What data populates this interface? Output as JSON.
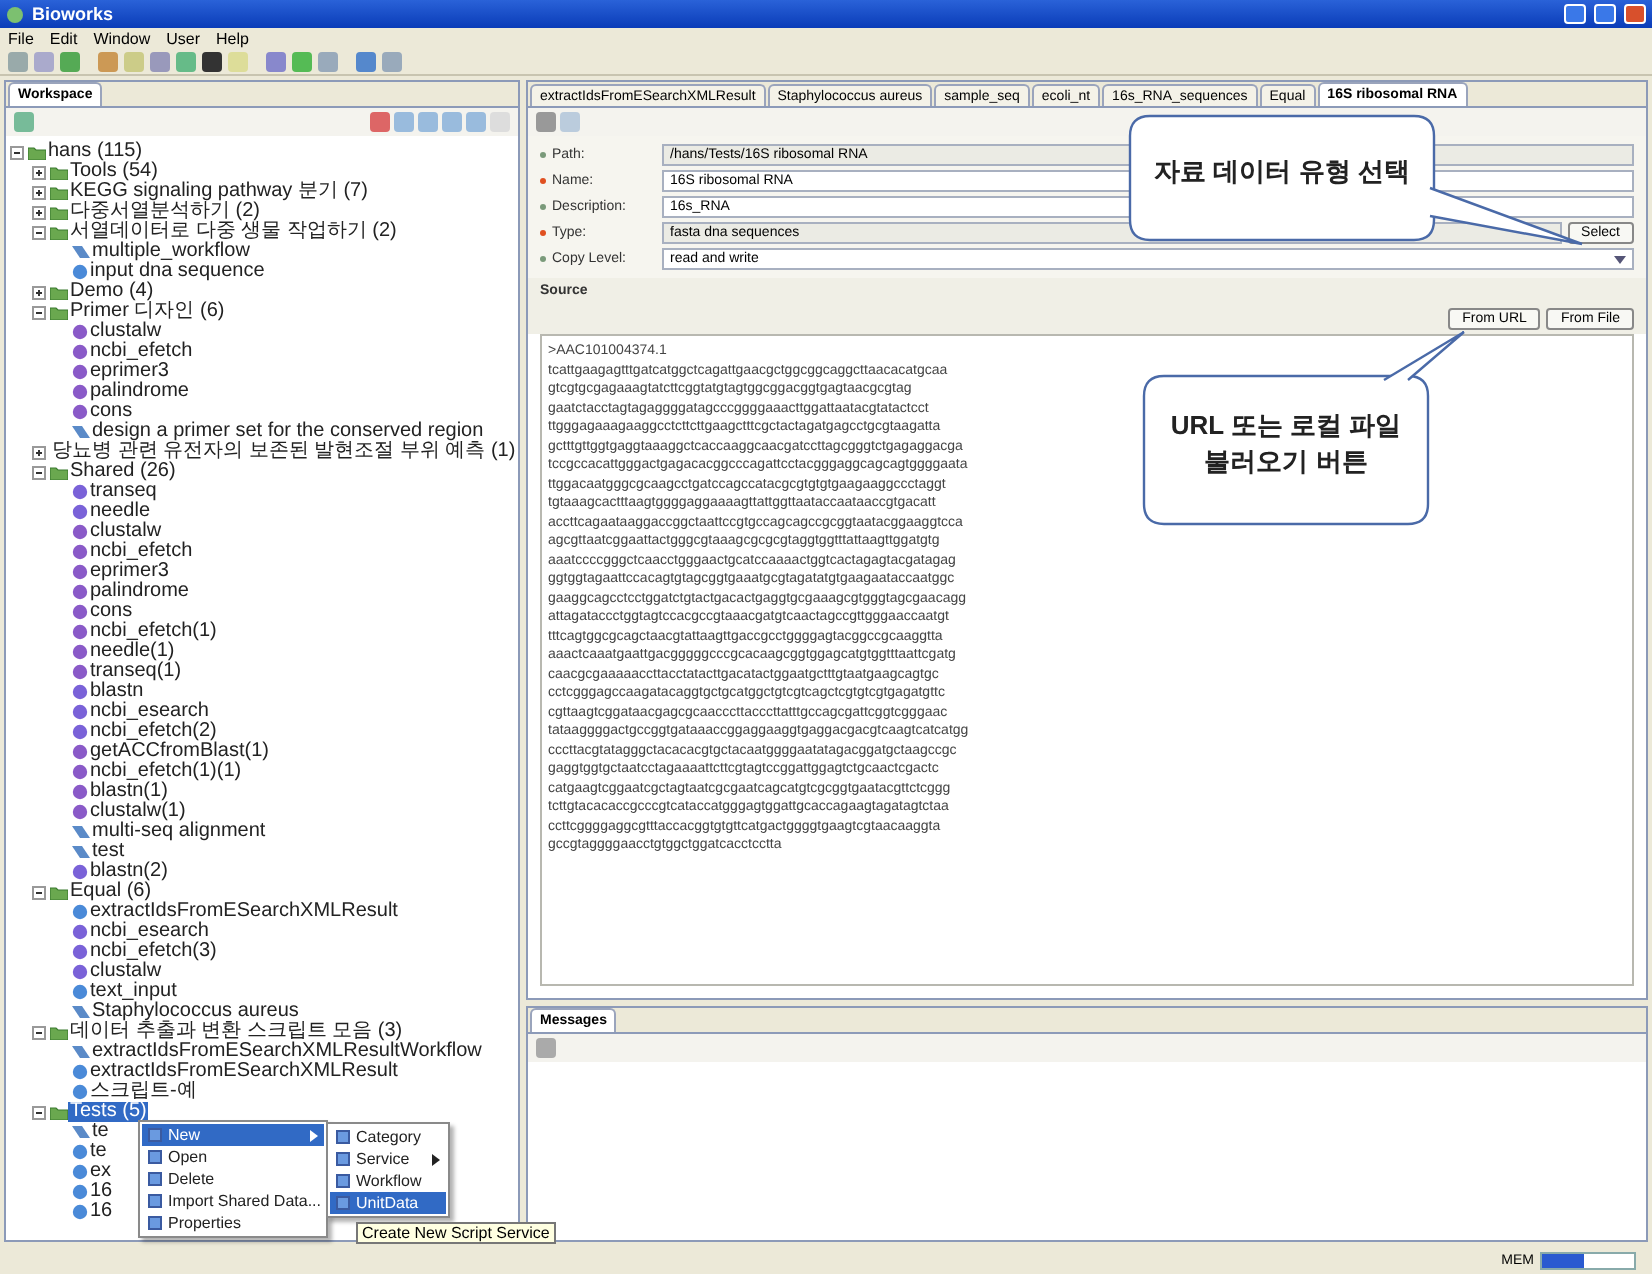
{
  "window": {
    "title": "Bioworks"
  },
  "menu": [
    "File",
    "Edit",
    "Window",
    "User",
    "Help"
  ],
  "workspace": {
    "title": "Workspace",
    "tree": [
      {
        "label": "hans (115)",
        "kind": "category",
        "expanded": true,
        "selected": false,
        "children": [
          {
            "label": "Tools (54)",
            "kind": "category",
            "expanded": false,
            "selected": false
          },
          {
            "label": "KEGG signaling pathway 분기 (7)",
            "kind": "category",
            "expanded": false,
            "selected": false
          },
          {
            "label": "다중서열분석하기 (2)",
            "kind": "category",
            "expanded": false,
            "selected": false
          },
          {
            "label": "서열데이터로 다중 생물 작업하기 (2)",
            "kind": "category",
            "expanded": true,
            "selected": false,
            "children": [
              {
                "label": "multiple_workflow",
                "kind": "workflow",
                "selected": false
              },
              {
                "label": "input dna sequence",
                "kind": "data",
                "selected": false
              }
            ]
          },
          {
            "label": "Demo (4)",
            "kind": "category",
            "expanded": false,
            "selected": false
          },
          {
            "label": "Primer 디자인 (6)",
            "kind": "category",
            "expanded": true,
            "selected": false,
            "children": [
              {
                "label": "clustalw",
                "kind": "service",
                "selected": false
              },
              {
                "label": "ncbi_efetch",
                "kind": "service",
                "selected": false
              },
              {
                "label": "eprimer3",
                "kind": "service",
                "selected": false
              },
              {
                "label": "palindrome",
                "kind": "service",
                "selected": false
              },
              {
                "label": "cons",
                "kind": "service",
                "selected": false
              },
              {
                "label": "design a primer set for the conserved region",
                "kind": "workflow",
                "selected": false
              }
            ]
          },
          {
            "label": "당뇨병 관련 유전자의 보존된 발현조절 부위 예측 (1)",
            "kind": "category",
            "expanded": false,
            "selected": false
          },
          {
            "label": "Shared (26)",
            "kind": "category",
            "expanded": true,
            "selected": false,
            "children": [
              {
                "label": "transeq",
                "kind": "script",
                "selected": false
              },
              {
                "label": "needle",
                "kind": "script",
                "selected": false
              },
              {
                "label": "clustalw",
                "kind": "service",
                "selected": false
              },
              {
                "label": "ncbi_efetch",
                "kind": "service",
                "selected": false
              },
              {
                "label": "eprimer3",
                "kind": "service",
                "selected": false
              },
              {
                "label": "palindrome",
                "kind": "service",
                "selected": false
              },
              {
                "label": "cons",
                "kind": "service",
                "selected": false
              },
              {
                "label": "ncbi_efetch(1)",
                "kind": "service",
                "selected": false
              },
              {
                "label": "needle(1)",
                "kind": "service",
                "selected": false
              },
              {
                "label": "transeq(1)",
                "kind": "service",
                "selected": false
              },
              {
                "label": "blastn",
                "kind": "script",
                "selected": false
              },
              {
                "label": "ncbi_esearch",
                "kind": "script",
                "selected": false
              },
              {
                "label": "ncbi_efetch(2)",
                "kind": "script",
                "selected": false
              },
              {
                "label": "getACCfromBlast(1)",
                "kind": "service",
                "selected": false
              },
              {
                "label": "ncbi_efetch(1)(1)",
                "kind": "service",
                "selected": false
              },
              {
                "label": "blastn(1)",
                "kind": "service",
                "selected": false
              },
              {
                "label": "clustalw(1)",
                "kind": "service",
                "selected": false
              },
              {
                "label": "multi-seq alignment",
                "kind": "workflow",
                "selected": false
              },
              {
                "label": "test",
                "kind": "workflow",
                "selected": false
              },
              {
                "label": "blastn(2)",
                "kind": "script",
                "selected": false
              }
            ]
          },
          {
            "label": "Equal (6)",
            "kind": "category",
            "expanded": true,
            "selected": false,
            "children": [
              {
                "label": "extractIdsFromESearchXMLResult",
                "kind": "data",
                "selected": false
              },
              {
                "label": "ncbi_esearch",
                "kind": "script",
                "selected": false
              },
              {
                "label": "ncbi_efetch(3)",
                "kind": "script",
                "selected": false
              },
              {
                "label": "clustalw",
                "kind": "script",
                "selected": false
              },
              {
                "label": "text_input",
                "kind": "data",
                "selected": false
              },
              {
                "label": "Staphylococcus aureus",
                "kind": "workflow",
                "selected": false
              }
            ]
          },
          {
            "label": "데이터 추출과 변환 스크립트 모음 (3)",
            "kind": "category",
            "expanded": true,
            "selected": false,
            "children": [
              {
                "label": "extractIdsFromESearchXMLResultWorkflow",
                "kind": "workflow",
                "selected": false
              },
              {
                "label": "extractIdsFromESearchXMLResult",
                "kind": "data",
                "selected": false
              },
              {
                "label": "스크립트-예",
                "kind": "data",
                "selected": false
              }
            ]
          },
          {
            "label": "Tests (5)",
            "kind": "category",
            "expanded": true,
            "selected": true,
            "children": [
              {
                "label": "te",
                "kind": "workflow",
                "selected": false
              },
              {
                "label": "te",
                "kind": "data",
                "selected": false
              },
              {
                "label": "ex",
                "kind": "data",
                "selected": false
              },
              {
                "label": "16",
                "kind": "data",
                "selected": false
              },
              {
                "label": "16",
                "kind": "data",
                "selected": false
              }
            ]
          }
        ]
      }
    ]
  },
  "context_menu": {
    "items": [
      {
        "label": "New",
        "submenu": true,
        "selected": true
      },
      {
        "label": "Open",
        "submenu": false,
        "selected": false
      },
      {
        "label": "Delete",
        "submenu": false,
        "selected": false
      },
      {
        "label": "Import Shared Data...",
        "submenu": false,
        "selected": false
      },
      {
        "label": "Properties",
        "submenu": false,
        "selected": false
      }
    ],
    "submenu": [
      {
        "label": "Category",
        "submenu": false,
        "selected": false
      },
      {
        "label": "Service",
        "submenu": true,
        "selected": false
      },
      {
        "label": "Workflow",
        "submenu": false,
        "selected": false
      },
      {
        "label": "UnitData",
        "submenu": false,
        "selected": true
      }
    ],
    "tooltip": "Create New Script Service"
  },
  "editor": {
    "tabs": [
      {
        "label": "extractIdsFromESearchXMLResult",
        "selected": false
      },
      {
        "label": "Staphylococcus aureus",
        "selected": false
      },
      {
        "label": "sample_seq",
        "selected": false
      },
      {
        "label": "ecoli_nt",
        "selected": false
      },
      {
        "label": "16s_RNA_sequences",
        "selected": false
      },
      {
        "label": "Equal",
        "selected": false
      },
      {
        "label": "16S ribosomal RNA",
        "selected": true
      }
    ],
    "fields": [
      {
        "label": "Path:",
        "value": "/hans/Tests/16S ribosomal RNA",
        "required": false,
        "kind": "readonly"
      },
      {
        "label": "Name:",
        "value": "16S ribosomal RNA",
        "required": true,
        "kind": "text"
      },
      {
        "label": "Description:",
        "value": "16s_RNA",
        "required": false,
        "kind": "text"
      },
      {
        "label": "Type:",
        "value": "fasta dna sequences",
        "required": true,
        "kind": "readonly",
        "button": "Select"
      },
      {
        "label": "Copy Level:",
        "value": "read and write",
        "required": false,
        "kind": "select"
      }
    ],
    "source": {
      "title": "Source",
      "buttons": [
        "From URL",
        "From File"
      ],
      "lines": [
        ">AAC101004374.1",
        "tcattgaagagtttgatcatggctcagattgaacgctggcggcaggcttaacacatgcaa",
        "gtcgtgcgagaaagtatcttcggtatgtagtggcggacggtgagtaacgcgtag",
        "gaatctacctagtagaggggatagcccggggaaacttggattaatacgtatactcct",
        "ttgggagaaagaaggcctcttcttgaagctttcgctactagatgagcctgcgtaagatta",
        "gctttgttggtgaggtaaaggctcaccaaggcaacgatccttagcgggtctgagaggacga",
        "tccgccacattgggactgagacacggcccagattcctacgggaggcagcagtggggaata",
        "ttggacaatgggcgcaagcctgatccagccatacgcgtgtgtgaagaaggccctaggt",
        "tgtaaagcactttaagtggggaggaaaagttattggttaataccaataaccgtgacatt",
        "accttcagaataaggaccggctaattccgtgccagcagccgcggtaatacggaaggtcca",
        "agcgttaatcggaattactgggcgtaaagcgcgcgtaggtggtttattaagttggatgtg",
        "aaatccccgggctcaacctgggaactgcatccaaaactggtcactagagtacgatagag",
        "ggtggtagaattccacagtgtagcggtgaaatgcgtagatatgtgaagaataccaatggc",
        "gaaggcagcctcctggatctgtactgacactgaggtgcgaaagcgtgggtagcgaacagg",
        "attagataccctggtagtccacgccgtaaacgatgtcaactagccgttgggaaccaatgt",
        "tttcagtggcgcagctaacgtattaagttgaccgcctggggagtacggccgcaaggtta",
        "aaactcaaatgaattgacgggggcccgcacaagcggtggagcatgtggtttaattcgatg",
        "caacgcgaaaaaccttacctatacttgacatactggaatgctttgtaatgaagcagtgc",
        "cctcgggagccaagatacaggtgctgcatggctgtcgtcagctcgtgtcgtgagatgttc",
        "cgttaagtcggataacgagcgcaacccttacccttatttgccagcgattcggtcgggaac",
        "tataaggggactgccggtgataaaccggaggaaggtgaggacgacgtcaagtcatcatgg",
        "cccttacgtatagggctacacacgtgctacaatggggaatatagacggatgctaagccgc",
        "gaggtggtgctaatcctagaaaattcttcgtagtccggattggagtctgcaactcgactc",
        "catgaagtcggaatcgctagtaatcgcgaatcagcatgtcgcggtgaatacgttctcggg",
        "tcttgtacacaccgcccgtcataccatgggagtggattgcaccagaagtagatagtctaa",
        "ccttcggggaggcgtttaccacggtgtgttcatgactggggtgaagtcgtaacaaggta",
        "gccgtaggggaacctgtggctggatcacctcctta"
      ]
    }
  },
  "callouts": [
    {
      "lines": [
        "자료 데이터 유형 선택"
      ]
    },
    {
      "lines": [
        "URL 또는 로컬 파일",
        "불러오기 버튼"
      ]
    }
  ],
  "messages": {
    "title": "Messages"
  },
  "status_bar": {
    "memory": {
      "label": "MEM",
      "level": 0.45
    }
  }
}
